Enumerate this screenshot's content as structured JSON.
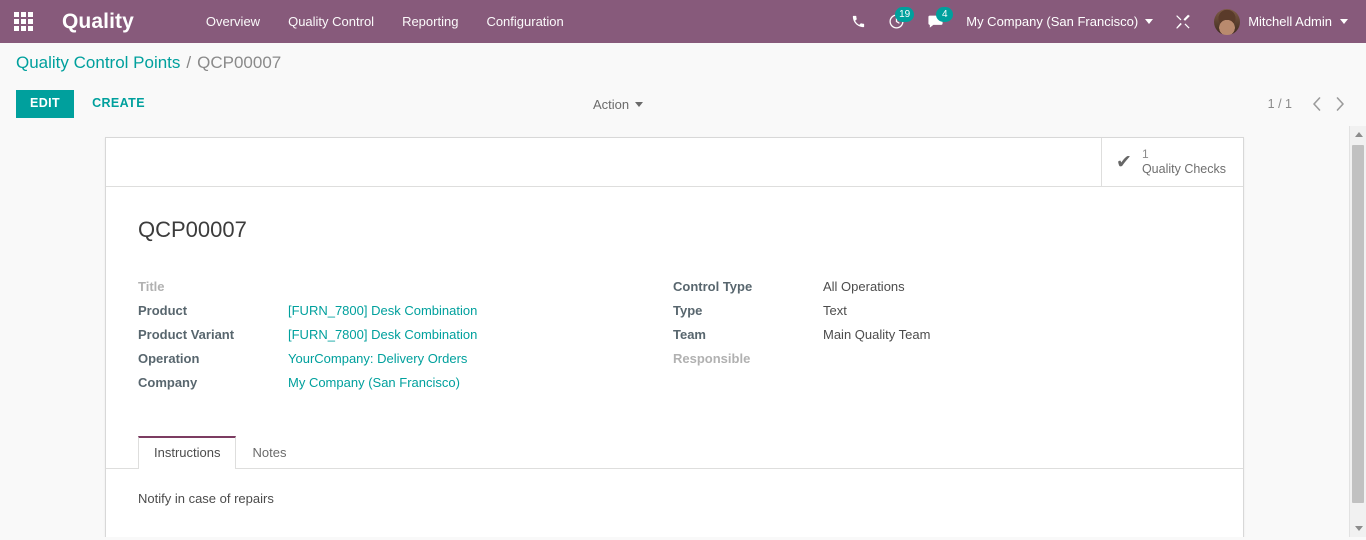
{
  "navbar": {
    "apps_icon": "apps-grid-icon",
    "brand": "Quality",
    "menus": [
      {
        "label": "Overview"
      },
      {
        "label": "Quality Control"
      },
      {
        "label": "Reporting"
      },
      {
        "label": "Configuration"
      }
    ],
    "icons": {
      "phone": "phone-icon",
      "activity": "clock-icon",
      "messages": "chat-bubble-icon",
      "tools": "tools-icon"
    },
    "activity_count": "19",
    "message_count": "4",
    "company": "My Company (San Francisco)",
    "user": "Mitchell Admin",
    "colors": {
      "navbar_bg": "#875A7B",
      "accent": "#00A09D",
      "badge": "#00A09D"
    }
  },
  "breadcrumb": {
    "root": "Quality Control Points",
    "separator": "/",
    "current": "QCP00007"
  },
  "control_panel": {
    "edit_label": "EDIT",
    "create_label": "CREATE",
    "action_label": "Action",
    "pager_value": "1 / 1",
    "prev_icon": "chevron-left-icon",
    "next_icon": "chevron-right-icon"
  },
  "stat_button": {
    "icon": "check-icon",
    "value": "1",
    "label": "Quality Checks"
  },
  "record": {
    "title": "QCP00007",
    "left_fields": [
      {
        "label": "Title",
        "value": "",
        "link": false,
        "empty_label": true
      },
      {
        "label": "Product",
        "value": "[FURN_7800] Desk Combination",
        "link": true,
        "empty_label": false
      },
      {
        "label": "Product Variant",
        "value": "[FURN_7800] Desk Combination",
        "link": true,
        "empty_label": false
      },
      {
        "label": "Operation",
        "value": "YourCompany: Delivery Orders",
        "link": true,
        "empty_label": false
      },
      {
        "label": "Company",
        "value": "My Company (San Francisco)",
        "link": true,
        "empty_label": false
      }
    ],
    "right_fields": [
      {
        "label": "Control Type",
        "value": "All Operations",
        "link": false,
        "empty_label": false
      },
      {
        "label": "Type",
        "value": "Text",
        "link": false,
        "empty_label": false
      },
      {
        "label": "Team",
        "value": "Main Quality Team",
        "link": false,
        "empty_label": false
      },
      {
        "label": "Responsible",
        "value": "",
        "link": false,
        "empty_label": true
      }
    ]
  },
  "notebook": {
    "tabs": [
      {
        "label": "Instructions",
        "active": true
      },
      {
        "label": "Notes",
        "active": false
      }
    ],
    "instructions_text": "Notify in case of repairs"
  }
}
